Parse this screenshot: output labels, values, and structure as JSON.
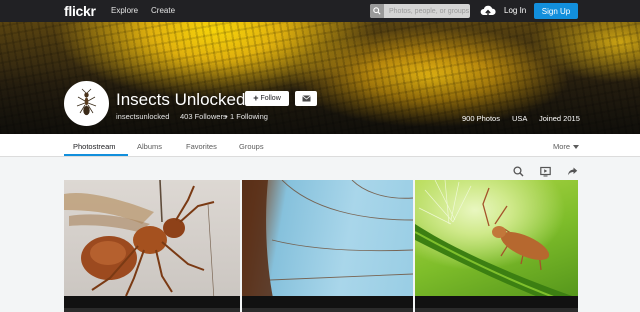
{
  "nav": {
    "logo": "flickr",
    "explore": "Explore",
    "create": "Create",
    "search_placeholder": "Photos, people, or groups",
    "login": "Log In",
    "signup": "Sign Up"
  },
  "profile": {
    "name": "Insects Unlocked",
    "follow_label": "Follow",
    "username": "insectsunlocked",
    "followers": "403 Followers",
    "following": "1 Following",
    "photos": "900 Photos",
    "country": "USA",
    "joined": "Joined 2015"
  },
  "tabs": {
    "photostream": "Photostream",
    "albums": "Albums",
    "favorites": "Favorites",
    "groups": "Groups",
    "more": "More"
  },
  "icons": [
    "search-icon",
    "upload-icon",
    "plus-icon",
    "mail-icon",
    "chevron-down-icon",
    "slideshow-icon",
    "share-icon"
  ],
  "colors": {
    "nav_bg": "#212124",
    "accent": "#128fdc"
  }
}
